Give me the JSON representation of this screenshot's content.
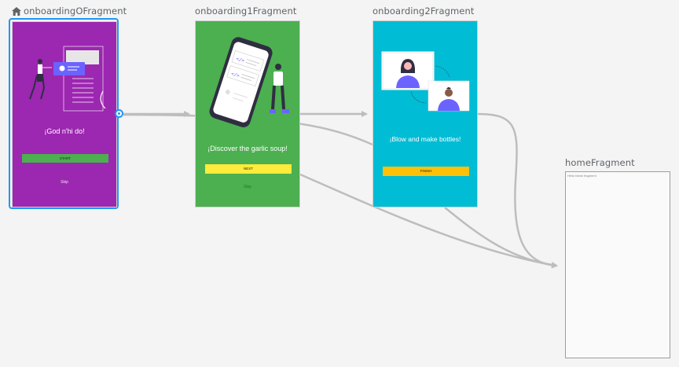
{
  "destinations": [
    {
      "id": "onboarding0",
      "title": "onboardingOFragment",
      "headline": "¡God n'hi do!",
      "button": "START",
      "skip": "Skip",
      "start_destination": true,
      "bg_color": "#9c27b0",
      "button_color": "#4caf50"
    },
    {
      "id": "onboarding1",
      "title": "onboarding1Fragment",
      "headline": "¡Discover the garlic soup!",
      "button": "NEXT",
      "skip": "Skip",
      "bg_color": "#4caf50",
      "button_color": "#ffeb3b"
    },
    {
      "id": "onboarding2",
      "title": "onboarding2Fragment",
      "headline": "¡Blow and make bottles!",
      "button": "FINISH",
      "bg_color": "#00bcd4",
      "button_color": "#ffc107"
    },
    {
      "id": "home",
      "title": "homeFragment",
      "body_text": "Hello blank fragment",
      "bg_color": "#fafafa"
    }
  ],
  "icons": {
    "start_destination": "home-icon",
    "action_handle": "circle-handle"
  },
  "colors": {
    "selection": "#2196f3",
    "arrow": "#bdbdbd",
    "illustration_accent": "#6c63ff"
  }
}
